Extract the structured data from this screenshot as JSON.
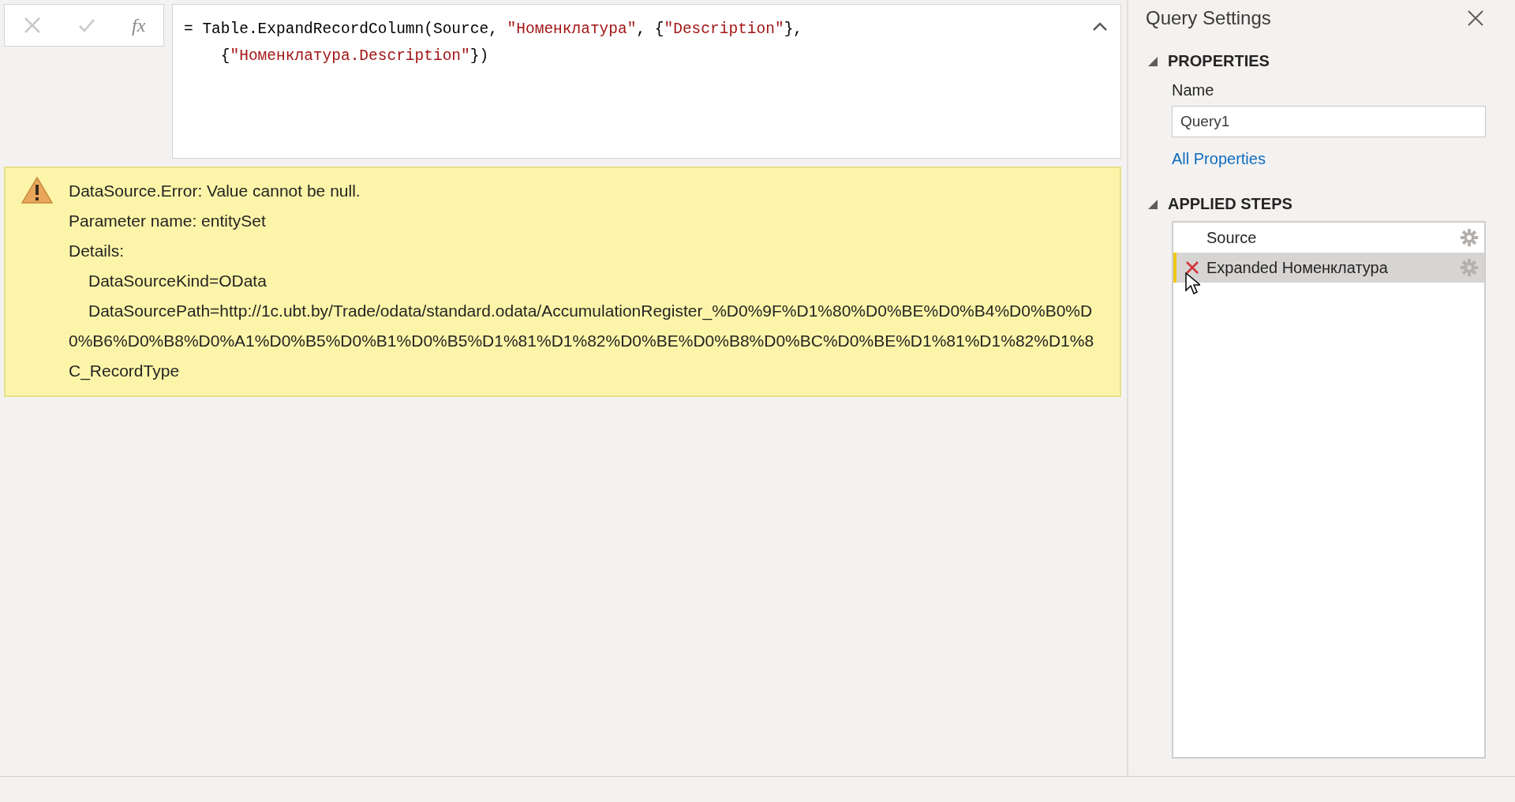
{
  "formula_bar": {
    "buttons": [
      {
        "kind": "cancel",
        "disabled": true
      },
      {
        "kind": "commit",
        "disabled": true
      },
      {
        "kind": "fx",
        "label": "fx"
      }
    ],
    "lines": [
      [
        {
          "kind": "code",
          "text": "= Table.ExpandRecordColumn(Source, "
        },
        {
          "kind": "string",
          "text": "\"Номенклатура\""
        },
        {
          "kind": "code",
          "text": ", {"
        },
        {
          "kind": "string",
          "text": "\"Description\""
        },
        {
          "kind": "code",
          "text": "},"
        }
      ],
      [
        {
          "kind": "code",
          "text": "    {"
        },
        {
          "kind": "string",
          "text": "\"Номенклатура.Description\""
        },
        {
          "kind": "code",
          "text": "})"
        }
      ]
    ],
    "expanded": true
  },
  "error": {
    "lines": [
      {
        "text": "DataSource.Error: Value cannot be null."
      },
      {
        "text": "Parameter name: entitySet"
      },
      {
        "text": "Details:",
        "children": [
          {
            "text": "DataSourceKind=OData"
          },
          {
            "text": "DataSourcePath=http://1c.ubt.by/Trade/odata/standard.odata/AccumulationRegister_%D0%9F%D1%80%D0%BE%D0%B4%D0%B0%D0%B6%D0%B8%D0%A1%D0%B5%D0%B1%D0%B5%D1%81%D1%82%D0%BE%D0%B8%D0%BC%D0%BE%D1%81%D1%82%D1%8C_RecordType"
          }
        ]
      }
    ]
  },
  "query_settings": {
    "title": "Query Settings",
    "properties": {
      "header": "PROPERTIES",
      "expanded": true,
      "name_label": "Name",
      "name_value": "Query1",
      "link": "All Properties"
    },
    "applied_steps": {
      "header": "APPLIED STEPS",
      "expanded": true,
      "steps": [
        {
          "label": "Source",
          "selected": false,
          "error": false
        },
        {
          "label": "Expanded Номенклатура",
          "selected": true,
          "error": true
        }
      ]
    }
  }
}
